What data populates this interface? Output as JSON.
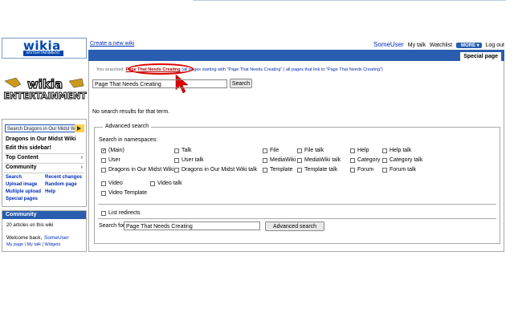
{
  "logo": {
    "text": "wikia",
    "sub": "ENTERTAINMENT"
  },
  "big_logo": {
    "top": "wikia",
    "bottom": "ENTERTAINMENT"
  },
  "header": {
    "create_wiki": "Create a new wiki",
    "username": "SomeUser",
    "my_talk": "My talk",
    "watchlist": "Watchlist",
    "more": "MORE",
    "logout": "Log out",
    "special_tab": "Special page"
  },
  "sidebar": {
    "search_placeholder": "Search Dragons in Our Midst W",
    "wiki_name": "Dragons in Our Midst Wiki",
    "edit_sidebar": "Edit this sidebar!",
    "top_content": "Top Content",
    "community": "Community",
    "links": [
      {
        "label": "Search"
      },
      {
        "label": "Recent changes"
      },
      {
        "label": "Upload image"
      },
      {
        "label": "Random page"
      },
      {
        "label": "Multiple upload"
      },
      {
        "label": "Help"
      },
      {
        "label": "Special pages"
      }
    ]
  },
  "community_box": {
    "title": "Community",
    "articles": "20 articles on this wiki",
    "welcome": "Welcome back,",
    "user": "SomeUser",
    "links": "My page | My talk | Widgets"
  },
  "search": {
    "you_searched": "You searched:",
    "query_link": "Page That Needs Creating",
    "rest": " (all pages starting with \"Page That Needs Creating\" | all pages that link to \"Page That Needs Creating\")",
    "query_value": "Page That Needs Creating",
    "button": "Search",
    "no_results": "No search results for that term."
  },
  "advanced": {
    "legend": "Advanced search",
    "ns_title": "Search in namespaces:",
    "namespaces": [
      {
        "label": "(Main)",
        "checked": true
      },
      {
        "label": "Talk",
        "checked": false
      },
      {
        "label": "File",
        "checked": false
      },
      {
        "label": "File talk",
        "checked": false
      },
      {
        "label": "Help",
        "checked": false
      },
      {
        "label": "Help talk",
        "checked": false
      },
      {
        "label": "User",
        "checked": false
      },
      {
        "label": "User talk",
        "checked": false
      },
      {
        "label": "MediaWiki",
        "checked": false
      },
      {
        "label": "MediaWiki talk",
        "checked": false
      },
      {
        "label": "Category",
        "checked": false
      },
      {
        "label": "Category talk",
        "checked": false
      },
      {
        "label": "Dragons in Our Midst Wiki",
        "checked": false
      },
      {
        "label": "Dragons in Our Midst Wiki talk",
        "checked": false
      },
      {
        "label": "Template",
        "checked": false
      },
      {
        "label": "Template talk",
        "checked": false
      },
      {
        "label": "Forum",
        "checked": false
      },
      {
        "label": "Forum talk",
        "checked": false
      },
      {
        "label": "Video",
        "checked": false
      },
      {
        "label": "Video talk",
        "checked": false
      },
      {
        "label": "Video Template",
        "checked": false
      }
    ],
    "list_redirects": "List redirects",
    "search_for": "Search for",
    "search_for_value": "Page That Needs Creating",
    "button": "Advanced search"
  }
}
